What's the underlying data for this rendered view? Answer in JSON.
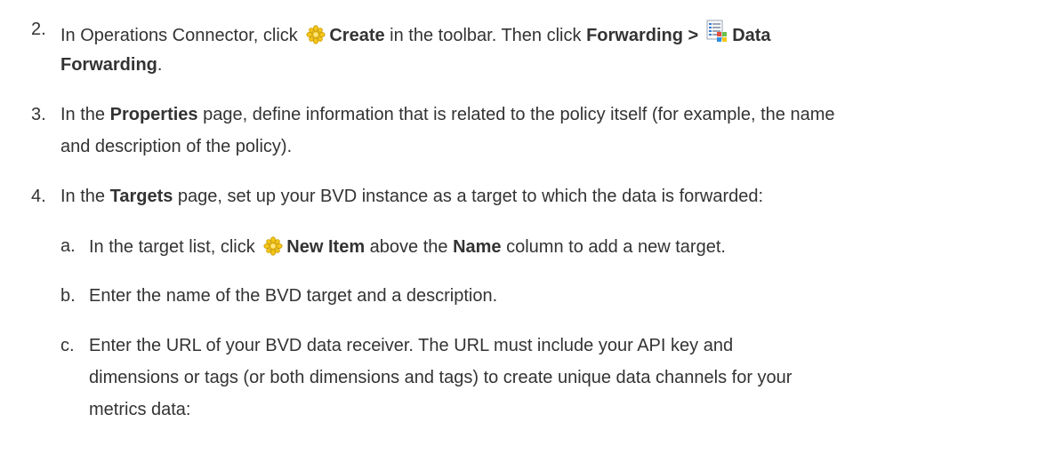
{
  "steps": [
    {
      "num": "2.",
      "line1": {
        "t1": "In Operations Connector, click ",
        "b1": "Create",
        "t2": " in the toolbar. Then click ",
        "b2": "Forwarding >",
        "b3": "Data"
      },
      "line2": {
        "b1": "Forwarding",
        "t1": "."
      },
      "icons": [
        "create-star-icon",
        "data-forwarding-icon"
      ]
    },
    {
      "num": "3.",
      "line1": {
        "t1": "In the ",
        "b1": "Properties",
        "t2": " page, define information that is related to the policy itself (for example, the name"
      },
      "line2": {
        "t1": "and description of the policy)."
      }
    },
    {
      "num": "4.",
      "line1": {
        "t1": "In the ",
        "b1": "Targets",
        "t2": " page, set up your BVD instance as a target to which the data is forwarded:"
      }
    }
  ],
  "substeps": [
    {
      "num": "a.",
      "line1": {
        "t1": "In the target list, click ",
        "b1": "New Item",
        "t2": " above the ",
        "b2": "Name",
        "t3": " column to add a new target."
      },
      "icons": [
        "new-item-star-icon"
      ]
    },
    {
      "num": "b.",
      "line1": {
        "t1": "Enter the name of the BVD target and a description."
      }
    },
    {
      "num": "c.",
      "lines": [
        "Enter the URL of your BVD data receiver. The URL must include your API key and",
        "dimensions or tags (or both dimensions and tags) to create unique data channels for your",
        "metrics data:"
      ]
    }
  ],
  "colors": {
    "text": "#333333",
    "star_fill": "#f5c518",
    "star_stroke": "#c79a00"
  }
}
